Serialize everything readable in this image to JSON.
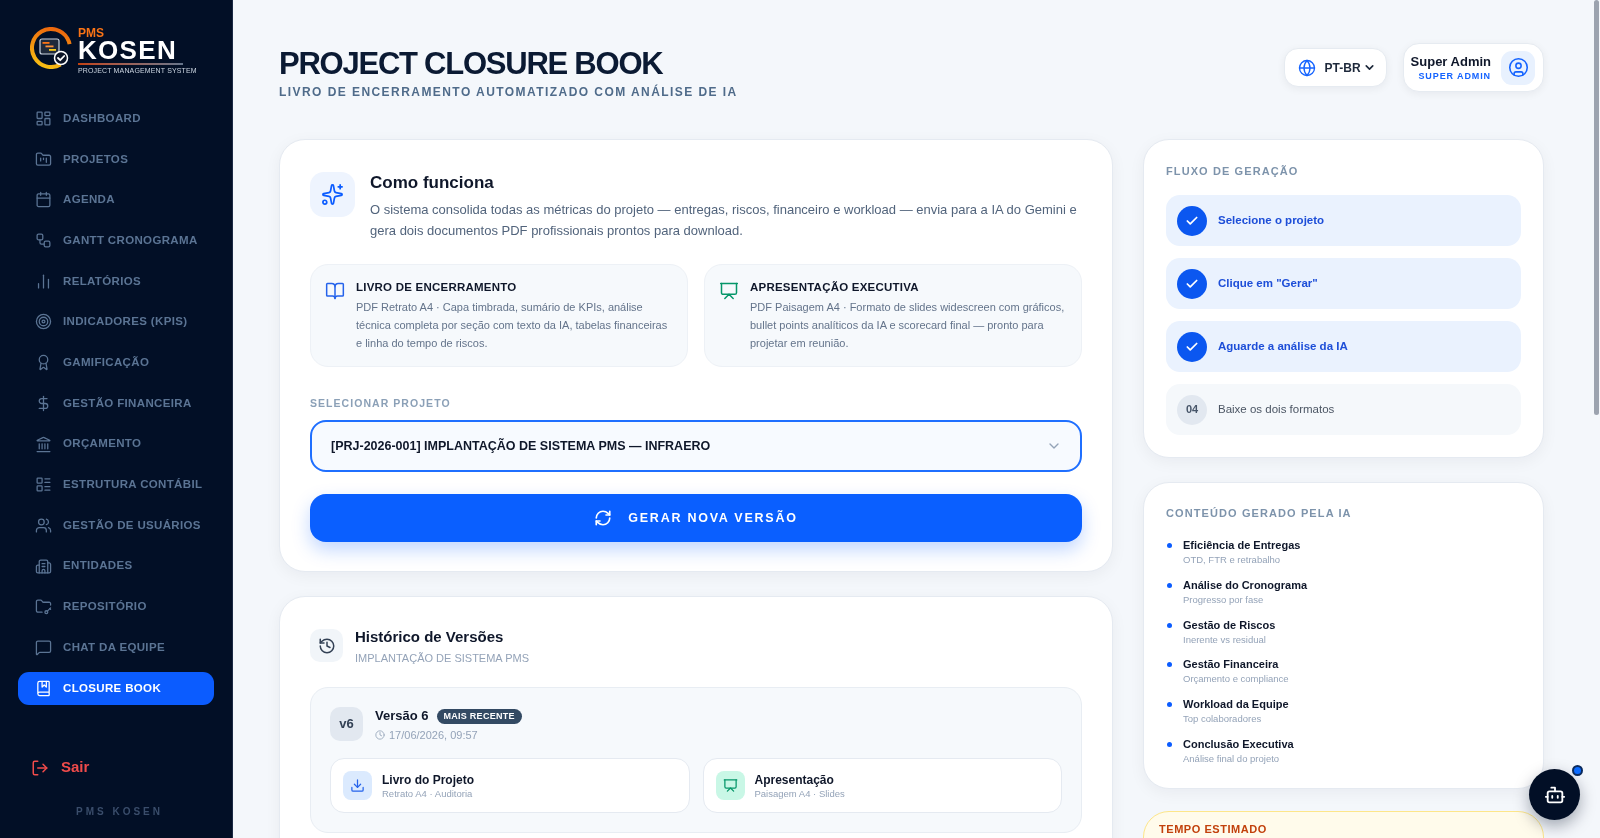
{
  "sidebar": {
    "logo": {
      "prefix": "PMS",
      "name": "KOSEN",
      "tagline": "PROJECT MANAGEMENT SYSTEM"
    },
    "items": [
      {
        "label": "DASHBOARD",
        "selected": false
      },
      {
        "label": "PROJETOS",
        "selected": false
      },
      {
        "label": "AGENDA",
        "selected": false
      },
      {
        "label": "GANTT CRONOGRAMA",
        "selected": false
      },
      {
        "label": "RELATÓRIOS",
        "selected": false
      },
      {
        "label": "INDICADORES (KPIS)",
        "selected": false
      },
      {
        "label": "GAMIFICAÇÃO",
        "selected": false
      },
      {
        "label": "GESTÃO FINANCEIRA",
        "selected": false
      },
      {
        "label": "ORÇAMENTO",
        "selected": false
      },
      {
        "label": "ESTRUTURA CONTÁBIL",
        "selected": false
      },
      {
        "label": "GESTÃO DE USUÁRIOS",
        "selected": false
      },
      {
        "label": "ENTIDADES",
        "selected": false
      },
      {
        "label": "REPOSITÓRIO",
        "selected": false
      },
      {
        "label": "CHAT DA EQUIPE",
        "selected": false
      },
      {
        "label": "CLOSURE BOOK",
        "selected": true
      }
    ],
    "logout": "Sair",
    "footer": "PMS KOSEN"
  },
  "header": {
    "title": "PROJECT CLOSURE BOOK",
    "subtitle": "LIVRO DE ENCERRAMENTO AUTOMATIZADO COM ANÁLISE DE IA",
    "language": "PT-BR",
    "user": {
      "name": "Super Admin",
      "role": "SUPER ADMIN"
    }
  },
  "how_it_works": {
    "title": "Como funciona",
    "description": "O sistema consolida todas as métricas do projeto — entregas, riscos, financeiro e workload — envia para a IA do Gemini e gera dois documentos PDF profissionais prontos para download.",
    "features": [
      {
        "kind": "book",
        "title": "LIVRO DE ENCERRAMENTO",
        "description": "PDF Retrato A4 · Capa timbrada, sumário de KPIs, análise técnica completa por seção com texto da IA, tabelas financeiras e linha do tempo de riscos."
      },
      {
        "kind": "presentation",
        "title": "APRESENTAÇÃO EXECUTIVA",
        "description": "PDF Paisagem A4 · Formato de slides widescreen com gráficos, bullet points analíticos da IA e scorecard final — pronto para projetar em reunião."
      }
    ],
    "project_select": {
      "label": "SELECIONAR PROJETO",
      "value": "[PRJ-2026-001] IMPLANTAÇÃO DE SISTEMA PMS — INFRAERO"
    },
    "generate_button": "GERAR NOVA VERSÃO"
  },
  "history": {
    "title": "Histórico de Versões",
    "subtitle": "IMPLANTAÇÃO DE SISTEMA PMS",
    "versions": [
      {
        "badge": "v6",
        "title": "Versão 6",
        "tag": "MAIS RECENTE",
        "date": "17/06/2026, 09:57",
        "files": [
          {
            "kind": "download",
            "title": "Livro do Projeto",
            "subtitle": "Retrato A4 · Auditoria"
          },
          {
            "kind": "presentation",
            "title": "Apresentação",
            "subtitle": "Paisagem A4 · Slides"
          }
        ]
      }
    ]
  },
  "generation_flow": {
    "title": "FLUXO DE GERAÇÃO",
    "steps": [
      {
        "label": "Selecione o projeto",
        "done": true
      },
      {
        "label": "Clique em \"Gerar\"",
        "done": true
      },
      {
        "label": "Aguarde a análise da IA",
        "done": true
      },
      {
        "label": "Baixe os dois formatos",
        "done": false,
        "number": "04"
      }
    ]
  },
  "ai_content": {
    "title": "CONTEÚDO GERADO PELA IA",
    "items": [
      {
        "title": "Eficiência de Entregas",
        "subtitle": "OTD, FTR e retrabalho"
      },
      {
        "title": "Análise do Cronograma",
        "subtitle": "Progresso por fase"
      },
      {
        "title": "Gestão de Riscos",
        "subtitle": "Inerente vs residual"
      },
      {
        "title": "Gestão Financeira",
        "subtitle": "Orçamento e compliance"
      },
      {
        "title": "Workload da Equipe",
        "subtitle": "Top colaboradores"
      },
      {
        "title": "Conclusão Executiva",
        "subtitle": "Análise final do projeto"
      }
    ]
  },
  "estimated_time": {
    "title": "TEMPO ESTIMADO"
  },
  "chat_button": {
    "notification": true
  }
}
